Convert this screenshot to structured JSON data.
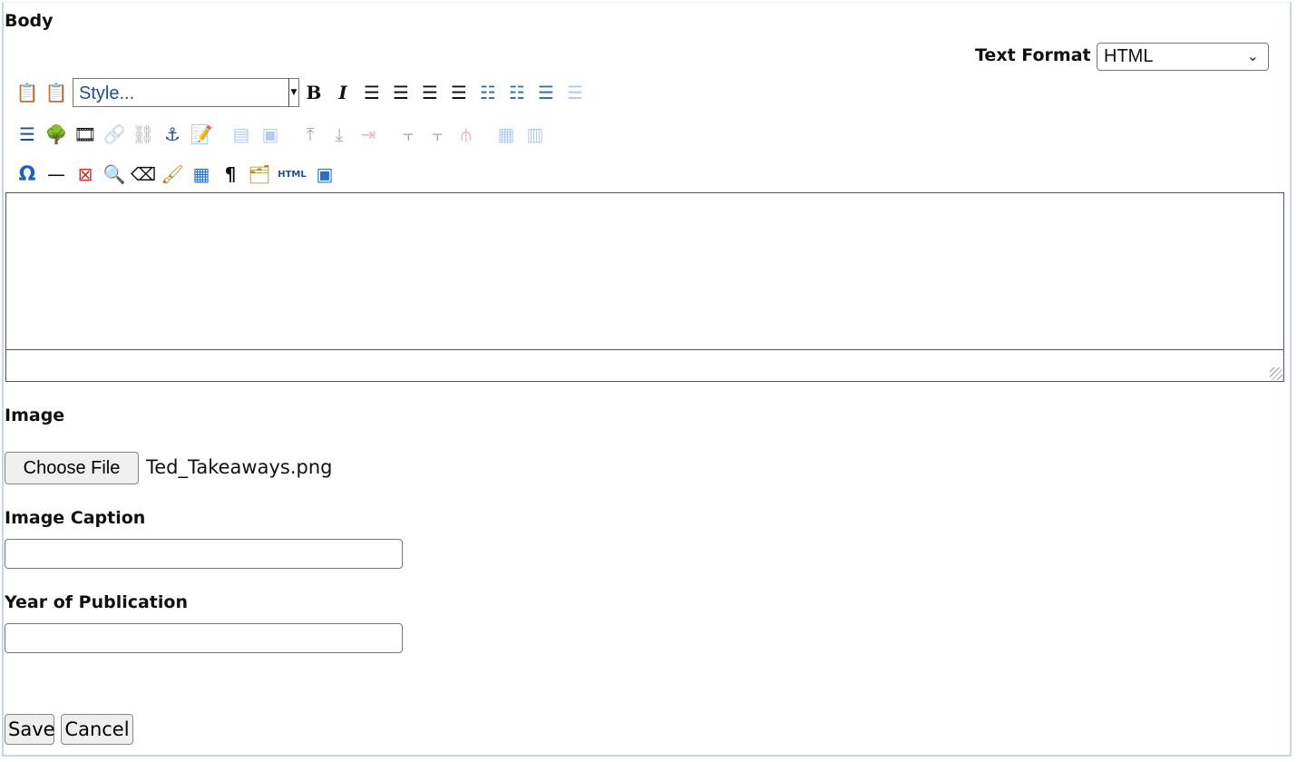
{
  "body_section": {
    "label": "Body",
    "text_format": {
      "label": "Text Format",
      "selected": "HTML"
    },
    "toolbar": {
      "style_placeholder": "Style...",
      "row1": [
        {
          "name": "paste-as-text-icon",
          "glyph": "📋",
          "disabled": false
        },
        {
          "name": "paste-from-word-icon",
          "glyph": "📋",
          "disabled": false
        },
        {
          "name": "bold-icon",
          "glyph": "B",
          "disabled": false
        },
        {
          "name": "italic-icon",
          "glyph": "I",
          "disabled": false
        },
        {
          "name": "align-left-icon",
          "glyph": "☰",
          "disabled": false
        },
        {
          "name": "align-center-icon",
          "glyph": "☰",
          "disabled": false
        },
        {
          "name": "align-right-icon",
          "glyph": "☰",
          "disabled": false
        },
        {
          "name": "align-justify-icon",
          "glyph": "☰",
          "disabled": false
        },
        {
          "name": "bulleted-list-icon",
          "glyph": "⁝☰",
          "disabled": false
        },
        {
          "name": "numbered-list-icon",
          "glyph": "⋮☰",
          "disabled": false
        },
        {
          "name": "outdent-icon",
          "glyph": "⇤",
          "disabled": false
        },
        {
          "name": "indent-icon",
          "glyph": "⇥",
          "disabled": true
        }
      ],
      "row2": [
        {
          "name": "indent-right-icon",
          "glyph": "⇶",
          "disabled": false
        },
        {
          "name": "insert-image-icon",
          "glyph": "🌳",
          "disabled": false
        },
        {
          "name": "insert-media-icon",
          "glyph": "🎞",
          "disabled": false
        },
        {
          "name": "insert-link-icon",
          "glyph": "🔗",
          "disabled": true
        },
        {
          "name": "unlink-icon",
          "glyph": "⛓",
          "disabled": true
        },
        {
          "name": "anchor-icon",
          "glyph": "⚓",
          "disabled": false
        },
        {
          "name": "insert-table-edit-icon",
          "glyph": "📝",
          "disabled": false
        },
        {
          "name": "table-row-props-icon",
          "glyph": "▤",
          "disabled": true,
          "gap": true
        },
        {
          "name": "table-cell-props-icon",
          "glyph": "▣",
          "disabled": true
        },
        {
          "name": "insert-row-before-icon",
          "glyph": "⤒",
          "disabled": true,
          "gap": true
        },
        {
          "name": "insert-row-after-icon",
          "glyph": "⤓",
          "disabled": true
        },
        {
          "name": "delete-row-icon",
          "glyph": "⇥",
          "disabled": true
        },
        {
          "name": "insert-col-before-icon",
          "glyph": "⫟",
          "disabled": true,
          "gap": true
        },
        {
          "name": "insert-col-after-icon",
          "glyph": "⫟",
          "disabled": true
        },
        {
          "name": "delete-col-icon",
          "glyph": "⫛",
          "disabled": true
        },
        {
          "name": "merge-cells-icon",
          "glyph": "▦",
          "disabled": true,
          "gap": true
        },
        {
          "name": "split-cells-icon",
          "glyph": "▥",
          "disabled": true
        }
      ],
      "row3": [
        {
          "name": "special-char-icon",
          "glyph": "Ω",
          "disabled": false
        },
        {
          "name": "horizontal-rule-icon",
          "glyph": "—",
          "disabled": false
        },
        {
          "name": "no-break-icon",
          "glyph": "⊠",
          "disabled": false
        },
        {
          "name": "find-replace-icon",
          "glyph": "🔍",
          "disabled": false
        },
        {
          "name": "eraser-icon",
          "glyph": "⌫",
          "disabled": false
        },
        {
          "name": "clean-up-icon",
          "glyph": "🖌",
          "disabled": false
        },
        {
          "name": "table-icon",
          "glyph": "▦",
          "disabled": false
        },
        {
          "name": "paragraph-marks-icon",
          "glyph": "¶",
          "disabled": false
        },
        {
          "name": "template-icon",
          "glyph": "🗂",
          "disabled": false
        },
        {
          "name": "html-source-icon",
          "glyph": "HTML",
          "disabled": false
        },
        {
          "name": "fullscreen-icon",
          "glyph": "▣",
          "disabled": false
        }
      ]
    },
    "editor_content": ""
  },
  "image_section": {
    "label": "Image",
    "choose_file_label": "Choose File",
    "file_name": "Ted_Takeaways.png"
  },
  "caption_section": {
    "label": "Image Caption",
    "value": ""
  },
  "year_section": {
    "label": "Year of Publication",
    "value": ""
  },
  "actions": {
    "save_label": "Save",
    "cancel_label": "Cancel"
  }
}
